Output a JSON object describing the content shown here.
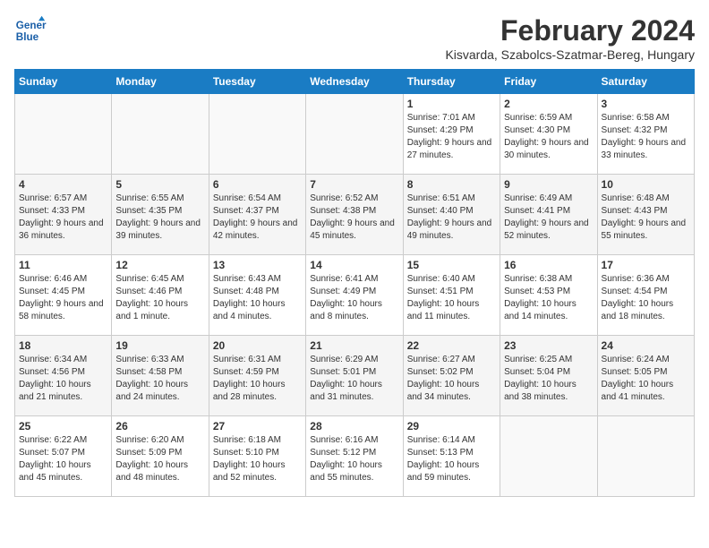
{
  "header": {
    "logo_text_general": "General",
    "logo_text_blue": "Blue",
    "month_title": "February 2024",
    "location": "Kisvarda, Szabolcs-Szatmar-Bereg, Hungary"
  },
  "days_of_week": [
    "Sunday",
    "Monday",
    "Tuesday",
    "Wednesday",
    "Thursday",
    "Friday",
    "Saturday"
  ],
  "weeks": [
    {
      "days": [
        {
          "number": "",
          "info": ""
        },
        {
          "number": "",
          "info": ""
        },
        {
          "number": "",
          "info": ""
        },
        {
          "number": "",
          "info": ""
        },
        {
          "number": "1",
          "info": "Sunrise: 7:01 AM\nSunset: 4:29 PM\nDaylight: 9 hours\nand 27 minutes."
        },
        {
          "number": "2",
          "info": "Sunrise: 6:59 AM\nSunset: 4:30 PM\nDaylight: 9 hours\nand 30 minutes."
        },
        {
          "number": "3",
          "info": "Sunrise: 6:58 AM\nSunset: 4:32 PM\nDaylight: 9 hours\nand 33 minutes."
        }
      ]
    },
    {
      "days": [
        {
          "number": "4",
          "info": "Sunrise: 6:57 AM\nSunset: 4:33 PM\nDaylight: 9 hours\nand 36 minutes."
        },
        {
          "number": "5",
          "info": "Sunrise: 6:55 AM\nSunset: 4:35 PM\nDaylight: 9 hours\nand 39 minutes."
        },
        {
          "number": "6",
          "info": "Sunrise: 6:54 AM\nSunset: 4:37 PM\nDaylight: 9 hours\nand 42 minutes."
        },
        {
          "number": "7",
          "info": "Sunrise: 6:52 AM\nSunset: 4:38 PM\nDaylight: 9 hours\nand 45 minutes."
        },
        {
          "number": "8",
          "info": "Sunrise: 6:51 AM\nSunset: 4:40 PM\nDaylight: 9 hours\nand 49 minutes."
        },
        {
          "number": "9",
          "info": "Sunrise: 6:49 AM\nSunset: 4:41 PM\nDaylight: 9 hours\nand 52 minutes."
        },
        {
          "number": "10",
          "info": "Sunrise: 6:48 AM\nSunset: 4:43 PM\nDaylight: 9 hours\nand 55 minutes."
        }
      ]
    },
    {
      "days": [
        {
          "number": "11",
          "info": "Sunrise: 6:46 AM\nSunset: 4:45 PM\nDaylight: 9 hours\nand 58 minutes."
        },
        {
          "number": "12",
          "info": "Sunrise: 6:45 AM\nSunset: 4:46 PM\nDaylight: 10 hours\nand 1 minute."
        },
        {
          "number": "13",
          "info": "Sunrise: 6:43 AM\nSunset: 4:48 PM\nDaylight: 10 hours\nand 4 minutes."
        },
        {
          "number": "14",
          "info": "Sunrise: 6:41 AM\nSunset: 4:49 PM\nDaylight: 10 hours\nand 8 minutes."
        },
        {
          "number": "15",
          "info": "Sunrise: 6:40 AM\nSunset: 4:51 PM\nDaylight: 10 hours\nand 11 minutes."
        },
        {
          "number": "16",
          "info": "Sunrise: 6:38 AM\nSunset: 4:53 PM\nDaylight: 10 hours\nand 14 minutes."
        },
        {
          "number": "17",
          "info": "Sunrise: 6:36 AM\nSunset: 4:54 PM\nDaylight: 10 hours\nand 18 minutes."
        }
      ]
    },
    {
      "days": [
        {
          "number": "18",
          "info": "Sunrise: 6:34 AM\nSunset: 4:56 PM\nDaylight: 10 hours\nand 21 minutes."
        },
        {
          "number": "19",
          "info": "Sunrise: 6:33 AM\nSunset: 4:58 PM\nDaylight: 10 hours\nand 24 minutes."
        },
        {
          "number": "20",
          "info": "Sunrise: 6:31 AM\nSunset: 4:59 PM\nDaylight: 10 hours\nand 28 minutes."
        },
        {
          "number": "21",
          "info": "Sunrise: 6:29 AM\nSunset: 5:01 PM\nDaylight: 10 hours\nand 31 minutes."
        },
        {
          "number": "22",
          "info": "Sunrise: 6:27 AM\nSunset: 5:02 PM\nDaylight: 10 hours\nand 34 minutes."
        },
        {
          "number": "23",
          "info": "Sunrise: 6:25 AM\nSunset: 5:04 PM\nDaylight: 10 hours\nand 38 minutes."
        },
        {
          "number": "24",
          "info": "Sunrise: 6:24 AM\nSunset: 5:05 PM\nDaylight: 10 hours\nand 41 minutes."
        }
      ]
    },
    {
      "days": [
        {
          "number": "25",
          "info": "Sunrise: 6:22 AM\nSunset: 5:07 PM\nDaylight: 10 hours\nand 45 minutes."
        },
        {
          "number": "26",
          "info": "Sunrise: 6:20 AM\nSunset: 5:09 PM\nDaylight: 10 hours\nand 48 minutes."
        },
        {
          "number": "27",
          "info": "Sunrise: 6:18 AM\nSunset: 5:10 PM\nDaylight: 10 hours\nand 52 minutes."
        },
        {
          "number": "28",
          "info": "Sunrise: 6:16 AM\nSunset: 5:12 PM\nDaylight: 10 hours\nand 55 minutes."
        },
        {
          "number": "29",
          "info": "Sunrise: 6:14 AM\nSunset: 5:13 PM\nDaylight: 10 hours\nand 59 minutes."
        },
        {
          "number": "",
          "info": ""
        },
        {
          "number": "",
          "info": ""
        }
      ]
    }
  ]
}
